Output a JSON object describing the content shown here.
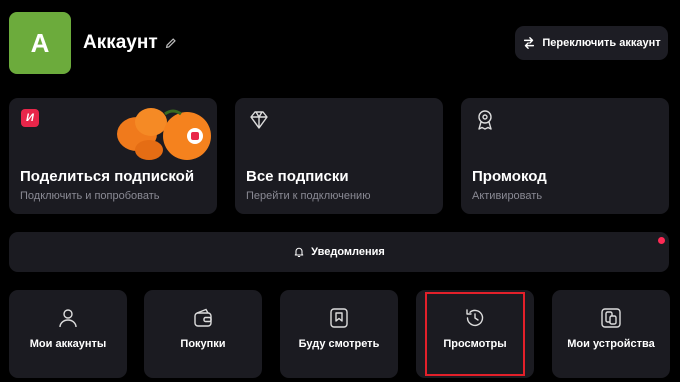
{
  "header": {
    "avatar_letter": "A",
    "avatar_color": "#6cab3c",
    "title": "Аккаунт",
    "switch_label": "Переключить аккаунт"
  },
  "cards": [
    {
      "title": "Поделиться подпиской",
      "subtitle": "Подключить и попробовать",
      "badge": "И",
      "icon": "mandarin-image"
    },
    {
      "title": "Все подписки",
      "subtitle": "Перейти к подключению",
      "icon": "diamond-icon"
    },
    {
      "title": "Промокод",
      "subtitle": "Активировать",
      "icon": "award-icon"
    }
  ],
  "notifications": {
    "label": "Уведомления",
    "dot_color": "#ff2a55"
  },
  "tiles": [
    {
      "label": "Мои аккаунты",
      "icon": "user-icon"
    },
    {
      "label": "Покупки",
      "icon": "wallet-icon"
    },
    {
      "label": "Буду смотреть",
      "icon": "bookmark-icon"
    },
    {
      "label": "Просмотры",
      "icon": "history-icon"
    },
    {
      "label": "Мои устройства",
      "icon": "devices-icon"
    }
  ],
  "colors": {
    "background": "#000000",
    "card": "#1b1b21",
    "accent_highlight": "#e3202a",
    "badge": "#e8264a"
  }
}
